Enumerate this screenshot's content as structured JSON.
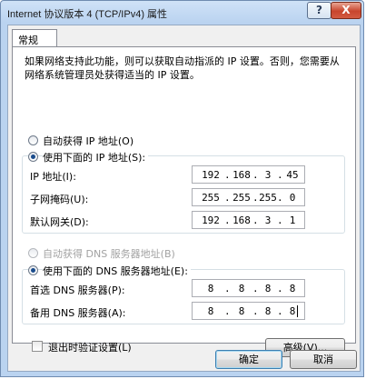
{
  "window": {
    "title": "Internet 协议版本 4 (TCP/IPv4) 属性",
    "help_label": "?",
    "close_label": "X"
  },
  "tab": {
    "label": "常规"
  },
  "description": "如果网络支持此功能，则可以获取自动指派的 IP 设置。否则，您需要从网络系统管理员处获得适当的 IP 设置。",
  "ip": {
    "auto_label": "自动获得 IP 地址(O)",
    "manual_label": "使用下面的 IP 地址(S):",
    "fields": [
      {
        "label": "IP 地址(I):",
        "octets": [
          "192",
          "168",
          "3",
          "45"
        ]
      },
      {
        "label": "子网掩码(U):",
        "octets": [
          "255",
          "255",
          "255",
          "0"
        ]
      },
      {
        "label": "默认网关(D):",
        "octets": [
          "192",
          "168",
          "3",
          "1"
        ]
      }
    ]
  },
  "dns": {
    "auto_label": "自动获得 DNS 服务器地址(B)",
    "manual_label": "使用下面的 DNS 服务器地址(E):",
    "fields": [
      {
        "label": "首选 DNS 服务器(P):",
        "octets": [
          "8",
          "8",
          "8",
          "8"
        ]
      },
      {
        "label": "备用 DNS 服务器(A):",
        "octets": [
          "8",
          "8",
          "8",
          "8"
        ]
      }
    ]
  },
  "validate_label": "退出时验证设置(L)",
  "advanced_label": "高级(V)...",
  "ok_label": "确定",
  "cancel_label": "取消"
}
